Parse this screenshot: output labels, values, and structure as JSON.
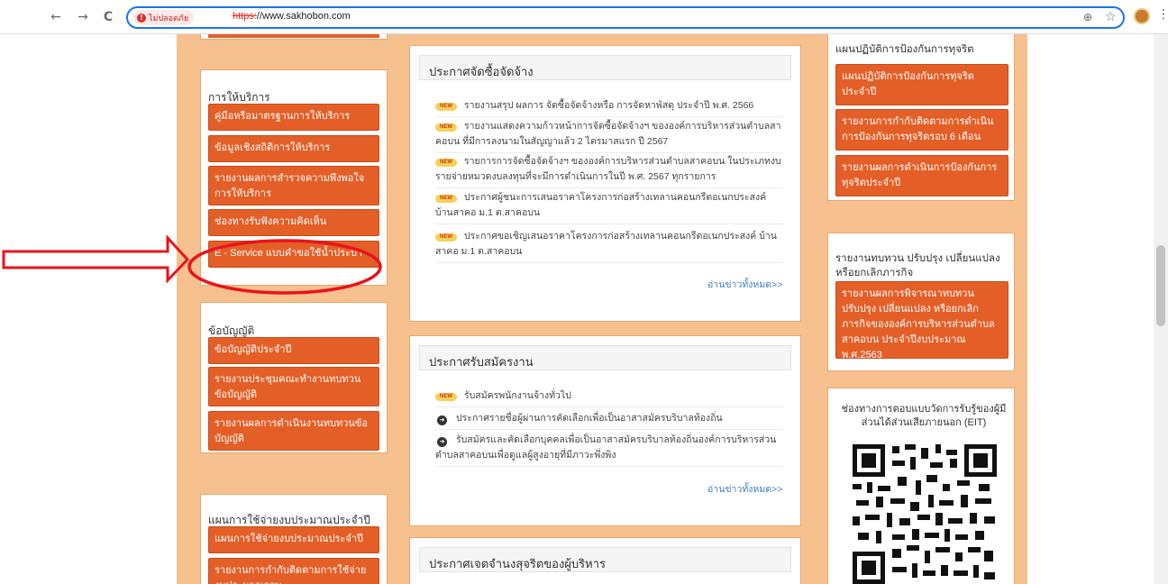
{
  "browser": {
    "back_icon": "←",
    "forward_icon": "→",
    "reload_icon": "C",
    "security_label": "ไม่ปลอดภัย",
    "url_scheme": "https:",
    "url_rest": "//www.sakhobon.com",
    "zoom_icon": "⊕",
    "star_icon": "☆",
    "menu_icon": "⋮"
  },
  "left": {
    "services": {
      "title": "การให้บริการ",
      "items": [
        "คู่มือหรือมาตรฐานการให้บริการ",
        "ข้อมูลเชิงสถิติการให้บริการ",
        "รายงานผลการสำรวจความพึงพอใจการให้บริการ",
        "ช่องทางรับฟังความคิดเห็น",
        "E - Service แบบคำขอใช้น้ำประปา"
      ]
    },
    "bylaws": {
      "title": "ข้อบัญญัติ",
      "items": [
        "ข้อบัญญัติประจำปี",
        "รายงานประชุมคณะทำงานทบทวนข้อบัญญัติ",
        "รายงานผลการดำเนินงานทบทวนข้อบัญญัติ"
      ]
    },
    "budget": {
      "title": "แผนการใช้จ่ายงบประมาณประจำปี",
      "items": [
        "แผนการใช้จ่ายงบประมาณประจำปี",
        "รายงานการกำกับติดตามการใช้จ่ายงบประมาณรอบ"
      ]
    }
  },
  "center": {
    "procurement": {
      "title": "ประกาศจัดซื้อจัดจ้าง",
      "new_label": "NEW",
      "items": [
        "รายงานสรุป ผลการ จัดซื้อจัดจ้างหรือ การจัดหาพัสดุ ประจำปี พ.ศ. 2566",
        "รายงานแสดงความก้าวหน้าการจัดซื้อจัดจ้างฯ ขององค์การบริหารส่วนตำบลสาคอบน ที่มีการลงนามในสัญญาแล้ว 2 ไตรมาสแรก ปี 2567",
        "รายการการจัดซื้อจัดจ้างฯ ขององค์การบริหารส่วนตำบลสาคอบน ในประเภทงบรายจ่ายหมวดงบลงทุนที่จะมีการดำเนินการในปี พ.ศ. 2567 ทุกรายการ",
        "ประกาศผู้ชนะการเสนอราคาโครงการก่อสร้างเทลานคอนกรีตอเนกประสงค์ บ้านสาคอ ม.1 ต.สาคอบน",
        "ประกาศขอเชิญเสนอราคาโครงการก่อสร้างเทลานคอนกรีตอเนกประสงค์ บ้านสาคอ ม.1 ต.สาคอบน"
      ],
      "read_more": "อ่านข่าวทั้งหมด>>"
    },
    "jobs": {
      "title": "ประกาศรับสมัครงาน",
      "items": [
        "รับสมัครพนักงานจ้างทั่วไป",
        "ประกาศรายชื่อผู้ผ่านการคัดเลือกเพื่อเป็นอาสาสมัครบริบาลท้องถิ่น",
        "รับสมัครและคัดเลือกบุคคลเพื่อเป็นอาสาสมัครบริบาลท้องถิ่นองค์การบริหารส่วนตำบลสาคอบนเพื่อดูแลผู้สูงอายุที่มีภาวะพึ่งพิง"
      ],
      "read_more": "อ่านข่าวทั้งหมด>>"
    },
    "intent": {
      "title": "ประกาศเจตจำนงสุจริตของผู้บริหาร"
    }
  },
  "right": {
    "anticorruption": {
      "title": "แผนปฏิบัติการป้องกันการทุจริต",
      "items": [
        "แผนปฏิบัติการป้องกันการทุจริตประจำปี",
        "รายงานการกำกับติดตามการดำเนินการป้องกันการทุจริตรอบ 6 เดือน",
        "รายงานผลการดำเนินการป้องกันการทุจริตประจำปี"
      ]
    },
    "review": {
      "title": "รายงานทบทวน ปรับปรุง เปลี่ยนแปลง หรือยกเลิกภารกิจ",
      "items": [
        "รายงานผลการพิจารณาทบทวน ปรับปรุง เปลี่ยนแปลง หรือยกเลิกภารกิจขององค์การบริหารส่วนตำบลสาคอบน ประจำปีงบประมาณ พ.ศ.2563"
      ]
    },
    "eit": {
      "title": "ช่องทางการตอบแบบวัดการรับรู้ของผู้มีส่วนได้ส่วนเสียภายนอก (EIT)"
    }
  },
  "colors": {
    "page_bg": "#f7c08f",
    "button": "#e45f27",
    "annotation": "#e8141b"
  }
}
